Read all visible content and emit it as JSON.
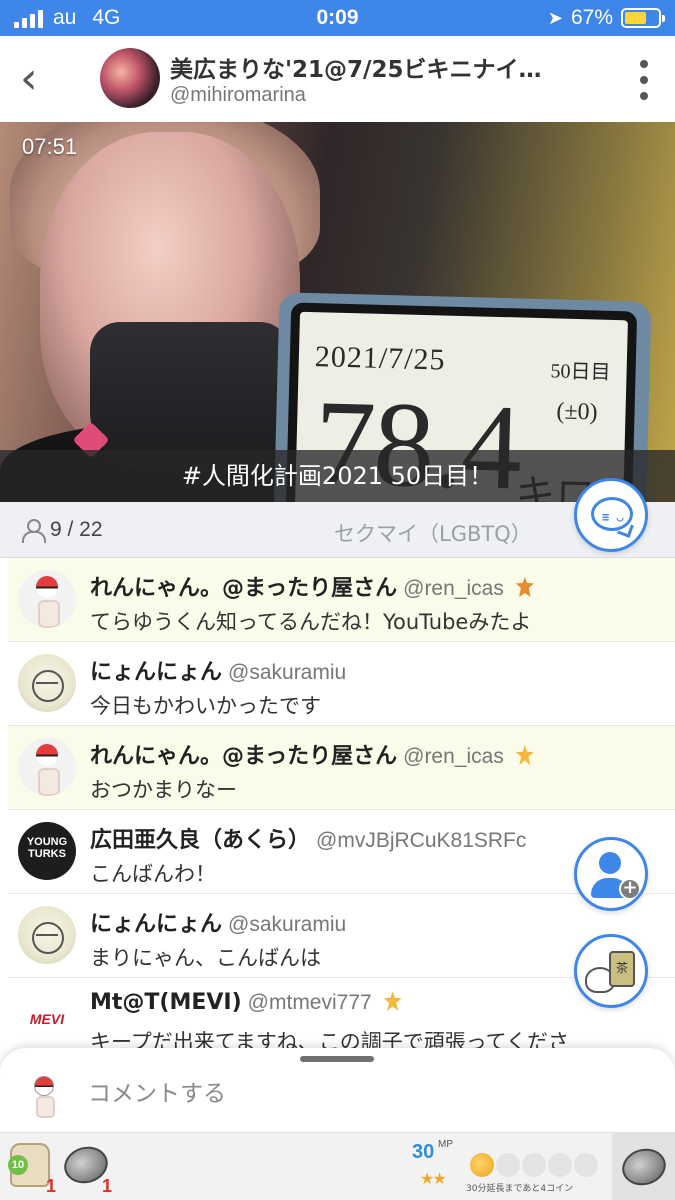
{
  "status_bar": {
    "carrier": "au",
    "network": "4G",
    "time": "0:09",
    "battery": "67%",
    "battery_level": 0.67
  },
  "header": {
    "title": "美広まりな'21@7/25ビキニナイ…",
    "handle": "@mihiromarina"
  },
  "video": {
    "timer": "07:51",
    "caption": "#人間化計画2021 50日目！",
    "board": {
      "date": "2021/7/25",
      "days": "50日目",
      "weight": "78.4",
      "diff": "(±0)",
      "unit": "キロ"
    }
  },
  "info": {
    "viewers": "9 / 22",
    "category": "セクマイ（LGBTQ）"
  },
  "comments": [
    {
      "name": "れんにゃん。@まったり屋さん",
      "handle": "@ren_icas",
      "text": "てらゆうくん知ってるんだね！YouTubeみたよ",
      "avatar": "pokeball",
      "highlight": true,
      "badge": "ribbon"
    },
    {
      "name": "にょんにょん",
      "handle": "@sakuramiu",
      "text": "今日もかわいかったです",
      "avatar": "sketch",
      "highlight": false,
      "badge": ""
    },
    {
      "name": "れんにゃん。@まったり屋さん",
      "handle": "@ren_icas",
      "text": "おつかまりなー",
      "avatar": "pokeball",
      "highlight": true,
      "badge": "star"
    },
    {
      "name": "広田亜久良（あくら）",
      "handle": "@mvJBjRCuK81SRFc",
      "text": "こんばんわ！",
      "avatar": "turks",
      "highlight": false,
      "badge": ""
    },
    {
      "name": "にょんにょん",
      "handle": "@sakuramiu",
      "text": "まりにゃん、こんばんは",
      "avatar": "sketch",
      "highlight": false,
      "badge": ""
    },
    {
      "name": "Mt@T(MEVI)",
      "handle": "@mtmevi777",
      "text": "キープだ出来てますね、この調子で頑張ってくださ",
      "avatar": "mevi",
      "highlight": false,
      "badge": "star"
    }
  ],
  "avatar_labels": {
    "turks": "YOUNG TURKS",
    "mevi": "MEVI"
  },
  "comment_box": {
    "placeholder": "コメントする"
  },
  "toolbar": {
    "seed_level": "10",
    "seed_count": "1",
    "coin_count": "1",
    "mp_value": "30",
    "mp_unit": "MP",
    "mp_stars": "★★",
    "extend_label": "30分延長まであと4コイン",
    "coins_filled": 1,
    "coins_total": 5
  },
  "colors": {
    "accent": "#3e86e8",
    "highlight_row": "#fafbe8",
    "badge": "#f4b73a"
  }
}
